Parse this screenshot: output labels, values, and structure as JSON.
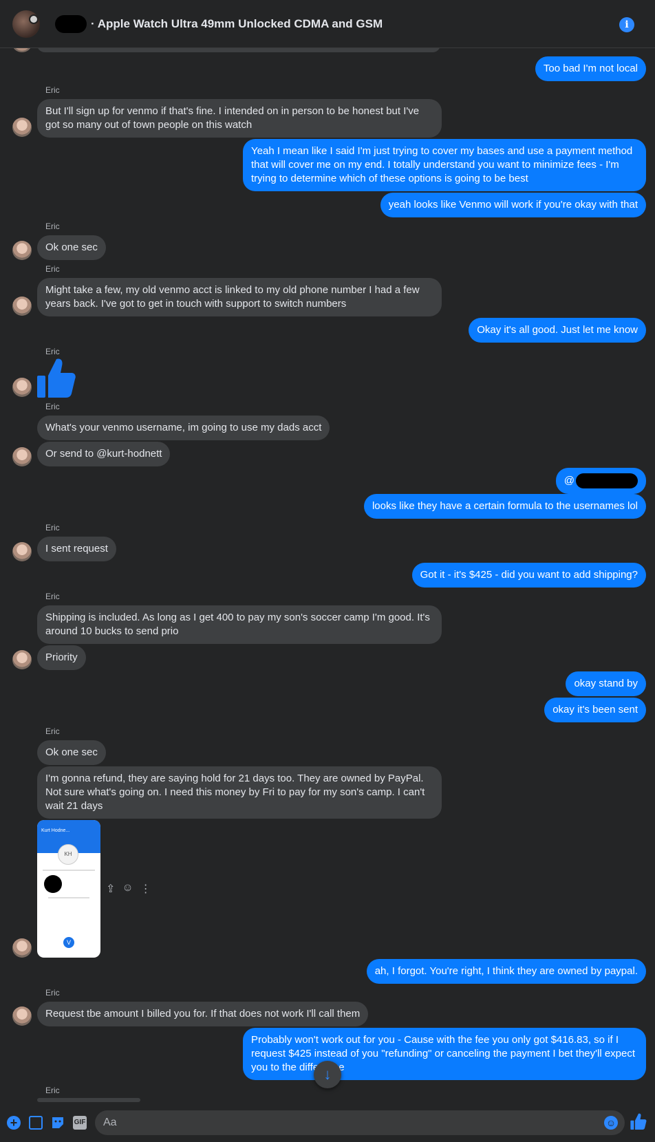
{
  "header": {
    "title": "· Apple Watch Ultra 49mm Unlocked CDMA and GSM"
  },
  "messages": {
    "m1": "Too bad I'm not local",
    "s1": "Eric",
    "m2": "But I'll sign up for venmo if that's fine. I intended on in person to be honest but I've got so many out of town people on this watch",
    "m3": "Yeah I mean like I said I'm just trying to cover my bases and use a payment method that will cover me on my end. I totally understand you want to minimize fees - I'm trying to determine which of these options is going to be best",
    "m4": "yeah looks like Venmo will work if you're okay with that",
    "s2": "Eric",
    "m5": "Ok one sec",
    "s3": "Eric",
    "m6": "Might take a few, my old venmo acct is linked to my old phone number I had a few years back. I've got to get in touch with support to switch numbers",
    "m7": "Okay it's all good. Just let me know",
    "s4": "Eric",
    "s5": "Eric",
    "m8": "What's your venmo username, im going to use my dads acct",
    "m9": "Or send to @kurt-hodnett",
    "m10": "@",
    "m11": "looks like they have a certain formula to the usernames lol",
    "s6": "Eric",
    "m12": "I sent request",
    "m13": "Got it - it's $425 - did you want to add shipping?",
    "s7": "Eric",
    "m14": "Shipping is included. As long as I get 400 to pay my son's soccer camp I'm good. It's around 10 bucks to send prio",
    "m15": "Priority",
    "m16": "okay stand by",
    "m17": "okay it's been sent",
    "s8": "Eric",
    "m18": "Ok one sec",
    "m19": "I'm gonna refund, they are saying hold for 21 days too. They are owned by PayPal. Not sure what's going on. I need this money by Fri to pay for my son's camp. I can't wait 21 days",
    "m20": "ah, I forgot. You're right, I think they are owned by paypal.",
    "s9": "Eric",
    "m21": "Request tbe amount I billed you for. If that does not work I'll call them",
    "m22": "Probably won't work out for you - Cause with the fee you only got $416.83, so if I request $425 instead of you \"refunding\" or canceling the payment I bet they'll expect you to      the difference",
    "s10": "Eric"
  },
  "screenshot_attachment": {
    "initials": "KH",
    "name": "Kurt Hodne...",
    "venmo_logo": "V"
  },
  "composer": {
    "placeholder": "Aa",
    "gif_label": "GIF"
  },
  "icons": {
    "info": "info-icon",
    "thumbs_up": "thumbs-up-icon",
    "scroll_down": "arrow-down-icon"
  },
  "colors": {
    "outgoing_bubble": "#0a7cff",
    "incoming_bubble": "#3e4042",
    "background": "#242526",
    "accent": "#2d88ff"
  }
}
